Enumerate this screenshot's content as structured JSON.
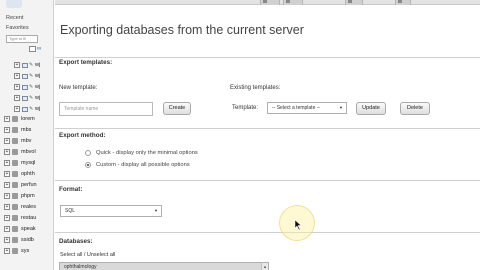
{
  "nav": {
    "recent_label": "Recent",
    "favorites_label": "Favorites",
    "filter_placeholder": "Type to fil",
    "top_tables": [
      {
        "label": "wj"
      },
      {
        "label": "wj"
      },
      {
        "label": "wj"
      },
      {
        "label": "wj"
      },
      {
        "label": "wj"
      }
    ],
    "databases": [
      {
        "label": "lorem"
      },
      {
        "label": "mbs"
      },
      {
        "label": "mbv"
      },
      {
        "label": "mbvol"
      },
      {
        "label": "mysql"
      },
      {
        "label": "ophth"
      },
      {
        "label": "perfun"
      },
      {
        "label": "phpm"
      },
      {
        "label": "reales"
      },
      {
        "label": "restau"
      },
      {
        "label": "speak"
      },
      {
        "label": "ssidb"
      },
      {
        "label": "sys"
      }
    ]
  },
  "page": {
    "title": "Exporting databases from the current server"
  },
  "templates": {
    "legend": "Export templates:",
    "new_label": "New template:",
    "name_placeholder": "Template name",
    "create_label": "Create",
    "existing_label": "Existing templates:",
    "template_label": "Template:",
    "select_value": "-- Select a template --",
    "update_label": "Update",
    "delete_label": "Delete"
  },
  "method": {
    "legend": "Export method:",
    "quick_label": "Quick - display only the minimal options",
    "custom_label": "Custom - display all possible options",
    "selected": "custom"
  },
  "format": {
    "legend": "Format:",
    "value": "SQL"
  },
  "databases": {
    "legend": "Databases:",
    "select_all_label": "Select all / Unselect all",
    "first_option": "ophthalmology"
  }
}
